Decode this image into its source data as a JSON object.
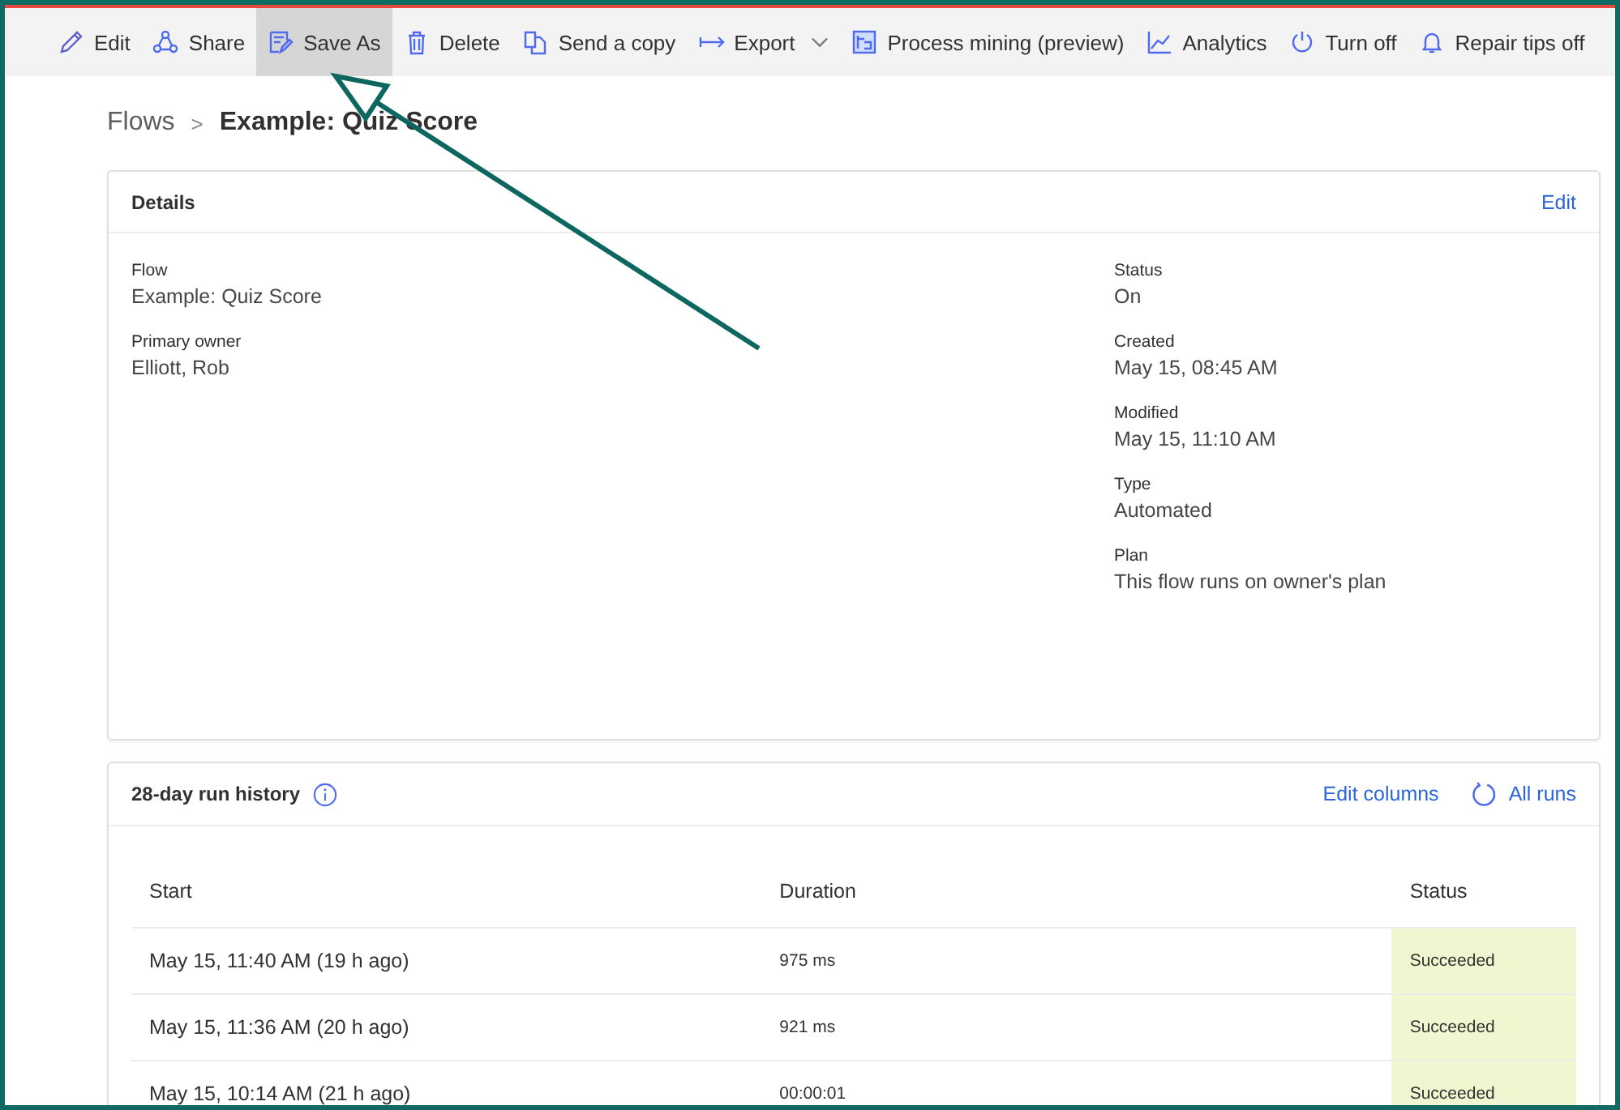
{
  "toolbar": [
    {
      "label": "Edit",
      "kind": "pencil",
      "selected": false
    },
    {
      "label": "Share",
      "kind": "share",
      "selected": false
    },
    {
      "label": "Save As",
      "kind": "saveas",
      "selected": true
    },
    {
      "label": "Delete",
      "kind": "trash",
      "selected": false
    },
    {
      "label": "Send a copy",
      "kind": "copy",
      "selected": false
    },
    {
      "label": "Export",
      "kind": "export",
      "selected": false,
      "dropdown": true
    },
    {
      "label": "Process mining (preview)",
      "kind": "mining",
      "selected": false
    },
    {
      "label": "Analytics",
      "kind": "chart",
      "selected": false
    },
    {
      "label": "Turn off",
      "kind": "power",
      "selected": false
    },
    {
      "label": "Repair tips off",
      "kind": "bell",
      "selected": false
    }
  ],
  "breadcrumb": {
    "parent": "Flows",
    "separator": ">",
    "current": "Example: Quiz Score"
  },
  "details": {
    "title": "Details",
    "edit_link": "Edit",
    "left": [
      {
        "label": "Flow",
        "value": "Example: Quiz Score"
      },
      {
        "label": "Primary owner",
        "value": "Elliott, Rob"
      }
    ],
    "right": [
      {
        "label": "Status",
        "value": "On"
      },
      {
        "label": "Created",
        "value": "May 15, 08:45 AM"
      },
      {
        "label": "Modified",
        "value": "May 15, 11:10 AM"
      },
      {
        "label": "Type",
        "value": "Automated"
      },
      {
        "label": "Plan",
        "value": "This flow runs on owner's plan"
      }
    ]
  },
  "run_history": {
    "title": "28-day run history",
    "edit_columns": "Edit columns",
    "all_runs": "All runs",
    "columns": [
      "Start",
      "Duration",
      "Status"
    ],
    "rows": [
      {
        "start": "May 15, 11:40 AM (19 h ago)",
        "duration": "975 ms",
        "status": "Succeeded",
        "color": "#f0f6d0"
      },
      {
        "start": "May 15, 11:36 AM (20 h ago)",
        "duration": "921 ms",
        "status": "Succeeded",
        "color": "#f0f6d0"
      },
      {
        "start": "May 15, 10:14 AM (21 h ago)",
        "duration": "00:00:01",
        "status": "Succeeded",
        "color": "#f0f6d0"
      }
    ]
  }
}
